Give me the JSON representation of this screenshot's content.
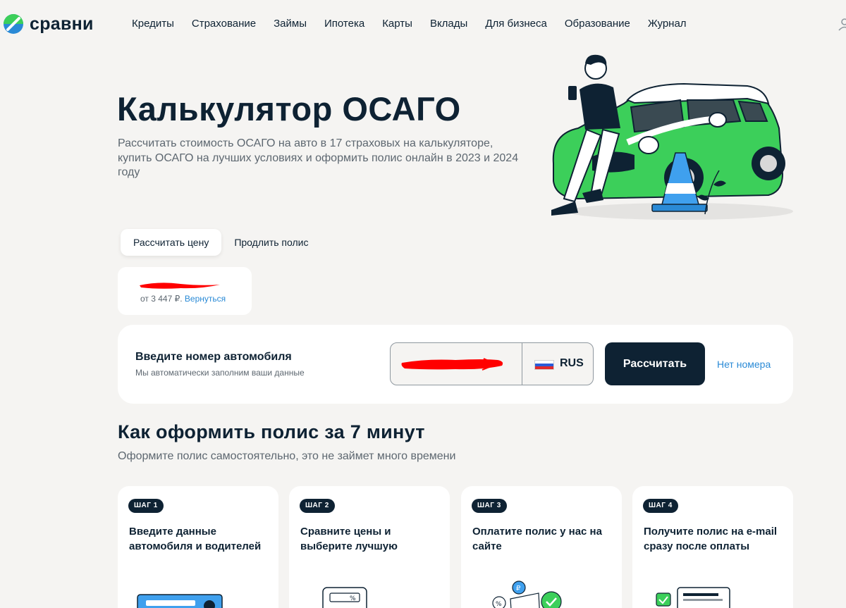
{
  "header": {
    "logo_text": "сравни",
    "nav": [
      "Кредиты",
      "Страхование",
      "Займы",
      "Ипотека",
      "Карты",
      "Вклады",
      "Для бизнеса",
      "Образование",
      "Журнал"
    ]
  },
  "hero": {
    "title": "Калькулятор ОСАГО",
    "subtitle": "Рассчитать стоимость ОСАГО на авто в 17 страховых на калькуляторе, купить ОСАГО на лучших условиях и оформить полис онлайн в 2023 и 2024 году"
  },
  "tabs": [
    {
      "label": "Рассчитать цену",
      "active": true
    },
    {
      "label": "Продлить полис",
      "active": false
    }
  ],
  "previous_calc": {
    "price_text": "от 3 447 ₽.",
    "back_link": "Вернуться"
  },
  "plate_form": {
    "title": "Введите номер автомобиля",
    "hint": "Мы автоматически заполним ваши данные",
    "region": "RUS",
    "submit_label": "Рассчитать",
    "no_number_link": "Нет номера"
  },
  "steps": {
    "title": "Как оформить полис за 7 минут",
    "subtitle": "Оформите полис самостоятельно, это не займет много времени",
    "items": [
      {
        "badge": "ШАГ 1",
        "text": "Введите данные автомобиля и водителей"
      },
      {
        "badge": "ШАГ 2",
        "text": "Сравните цены и выберите лучшую"
      },
      {
        "badge": "ШАГ 3",
        "text": "Оплатите полис у нас на сайте"
      },
      {
        "badge": "ШАГ 4",
        "text": "Получите полис на e-mail сразу после оплаты"
      }
    ]
  },
  "icons": {
    "logo": "sravni-logo-icon",
    "user": "user-icon",
    "flag": "russia-flag-icon"
  },
  "colors": {
    "brand_dark": "#0e2233",
    "brand_green": "#3ccf5a",
    "link": "#2a8ad6",
    "redaction": "#ff0000"
  }
}
